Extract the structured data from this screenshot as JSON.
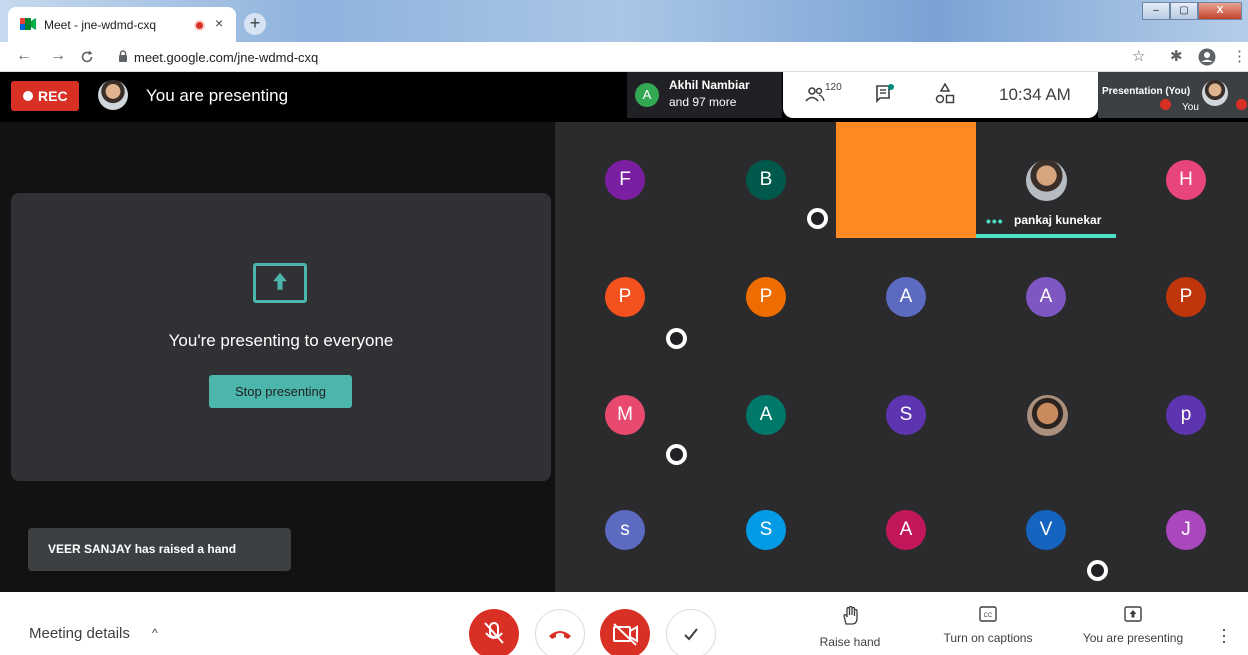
{
  "browser": {
    "tab_title": "Meet - jne-wdmd-cxq",
    "tab_close": "×",
    "new_tab": "+",
    "url": "meet.google.com/jne-wdmd-cxq",
    "win_minimize": "–",
    "win_maximize": "▢",
    "win_close": "X"
  },
  "top_bar": {
    "rec_label": "REC",
    "presenting_label": "You are presenting",
    "speaker_initial": "A",
    "speaker_name": "Akhil Nambiar",
    "speaker_more": "and 97 more",
    "people_count": "120",
    "clock": "10:34 AM",
    "self_thumb_label": "Presentation (You)",
    "self_you": "You"
  },
  "present_panel": {
    "heading": "You're presenting to everyone",
    "stop_button": "Stop presenting",
    "toast": "VEER SANJAY has raised a hand"
  },
  "participants": {
    "row1": [
      "F",
      "B",
      "H"
    ],
    "pankaj_dots": "•••",
    "pankaj_name": "pankaj kunekar",
    "row2": [
      "P",
      "P",
      "A",
      "A",
      "P"
    ],
    "row3": [
      "M",
      "A",
      "S",
      "p"
    ],
    "row4": [
      "s",
      "S",
      "A",
      "V",
      "J"
    ],
    "colors": {
      "purple": "#7b1fa2",
      "dark_green": "#00594a",
      "pink": "#e8457b",
      "deep_orange": "#f4511e",
      "orange": "#ef6c00",
      "indigo": "#5c6bc0",
      "violet": "#7e57c2",
      "brick": "#bf360c",
      "rose": "#e84a6f",
      "teal": "#00796b",
      "deep_purple": "#5e35b1",
      "soft_indigo": "#5c6bc0",
      "blue": "#039be5",
      "crimson": "#c2185b",
      "navy": "#1565c0",
      "magenta": "#ab47bc"
    }
  },
  "controls": {
    "meeting_details": "Meeting details",
    "chevron": "^",
    "raise_hand": "Raise hand",
    "captions": "Turn on captions",
    "you_are_presenting": "You are presenting"
  },
  "icons": [
    "meet-favicon",
    "recording-icon",
    "close-icon",
    "plus-icon",
    "back-icon",
    "forward-icon",
    "reload-icon",
    "lock-icon",
    "star-icon",
    "extensions-icon",
    "profile-icon",
    "menu-icon",
    "people-icon",
    "chat-icon",
    "activities-icon",
    "hand-icon",
    "mic-off-icon",
    "end-call-icon",
    "camera-off-icon",
    "check-icon",
    "captions-icon",
    "present-icon",
    "more-icon"
  ]
}
